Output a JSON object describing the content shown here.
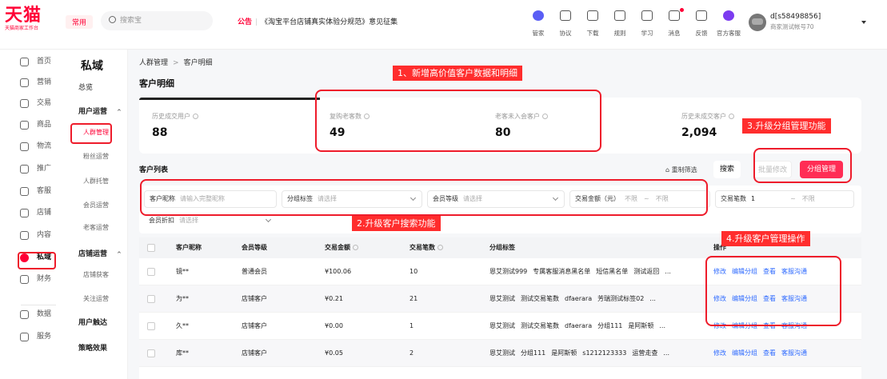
{
  "brand": {
    "logo": "天猫",
    "logo_sub": "天猫商家工作台"
  },
  "header": {
    "common_label": "常用",
    "search_placeholder": "搜索宝",
    "notice_tag": "公告",
    "notice_sep": "|",
    "notice_text": "《淘宝平台店铺真实体验分规范》意见征集",
    "tools": [
      {
        "name": "manager",
        "label": "管家",
        "icon": "manager-icon"
      },
      {
        "name": "agreement",
        "label": "协议",
        "icon": "agreement-icon"
      },
      {
        "name": "download",
        "label": "下载",
        "icon": "download-icon"
      },
      {
        "name": "rules",
        "label": "规则",
        "icon": "rules-icon"
      },
      {
        "name": "learn",
        "label": "学习",
        "icon": "learn-icon"
      },
      {
        "name": "message",
        "label": "消息",
        "icon": "message-icon"
      },
      {
        "name": "feedback",
        "label": "反馈",
        "icon": "feedback-icon"
      },
      {
        "name": "official-service",
        "label": "官方客服",
        "icon": "service-icon"
      }
    ],
    "user_name": "d[s58498856]",
    "user_sub": "商家测试帐号70"
  },
  "leftnav": [
    {
      "label": "首页",
      "icon": "home-icon"
    },
    {
      "label": "营销",
      "icon": "marketing-icon"
    },
    {
      "label": "交易",
      "icon": "trade-icon"
    },
    {
      "label": "商品",
      "icon": "goods-icon"
    },
    {
      "label": "物流",
      "icon": "logistics-icon"
    },
    {
      "label": "推广",
      "icon": "promotion-icon"
    },
    {
      "label": "客服",
      "icon": "customer-service-icon"
    },
    {
      "label": "店铺",
      "icon": "shop-icon"
    },
    {
      "label": "内容",
      "icon": "content-icon"
    },
    {
      "label": "私域",
      "icon": "private-domain-icon"
    },
    {
      "label": "财务",
      "icon": "finance-icon"
    },
    {
      "label": "数据",
      "icon": "data-icon"
    },
    {
      "label": "服务",
      "icon": "service-grid-icon"
    }
  ],
  "subnav": {
    "title": "私域",
    "overview": "总览",
    "group1": "用户运营",
    "group1_items": [
      "人群管理",
      "粉丝运营",
      "人群托管",
      "会员运营",
      "老客运营"
    ],
    "group2": "店铺运营",
    "group2_items": [
      "店铺获客",
      "关注运营"
    ],
    "group3": "用户触达",
    "group4": "策略效果",
    "collapse_arrow": "^"
  },
  "main": {
    "breadcrumb": [
      "人群管理",
      "客户明细"
    ],
    "breadcrumb_sep": ">",
    "page_title": "客户明细",
    "stats": [
      {
        "label": "历史成交用户",
        "value": "88"
      },
      {
        "label": "复购老客数",
        "value": "49"
      },
      {
        "label": "老客未入会客户",
        "value": "80"
      },
      {
        "label": "历史未成交客户",
        "value": "2,094"
      }
    ],
    "list_title": "客户列表",
    "reset_label": "重制筛选",
    "search_btn": "搜索",
    "batch_btn": "批量修改",
    "group_btn": "分组管理",
    "filters": {
      "nickname_label": "客户昵称",
      "nickname_placeholder": "请输入完整昵称",
      "group_tag_label": "分组标签",
      "group_tag_placeholder": "请选择",
      "member_level_label": "会员等级",
      "member_level_placeholder": "请选择",
      "amount_label": "交易金额（元）",
      "amount_from": "不限",
      "amount_to": "不限",
      "count_label": "交易笔数",
      "count_from": "1",
      "count_to": "不限",
      "range_sep": "~",
      "discount_label": "会员折扣",
      "discount_placeholder": "请选择"
    },
    "table": {
      "headers": {
        "nickname": "客户昵称",
        "level": "会员等级",
        "amount": "交易金额",
        "count": "交易笔数",
        "tags": "分组标签",
        "ops": "操作"
      },
      "rows": [
        {
          "nickname": "镜**",
          "level": "普通会员",
          "amount": "¥100.06",
          "count": "10",
          "tags": [
            "恩艾测试999",
            "专属客服消息黑名单",
            "短信黑名单",
            "测试返回",
            "..."
          ]
        },
        {
          "nickname": "为**",
          "level": "店铺客户",
          "amount": "¥0.21",
          "count": "21",
          "tags": [
            "恩艾测试",
            "测试交易笔数",
            "dfaerara",
            "芳瑞测试标签02",
            "..."
          ]
        },
        {
          "nickname": "久**",
          "level": "店铺客户",
          "amount": "¥0.00",
          "count": "1",
          "tags": [
            "恩艾测试",
            "测试交易笔数",
            "dfaerara",
            "分组111",
            "是阿斯顿",
            "..."
          ]
        },
        {
          "nickname": "库**",
          "level": "店铺客户",
          "amount": "¥0.05",
          "count": "2",
          "tags": [
            "恩艾测试",
            "分组111",
            "是阿斯顿",
            "s1212123333",
            "运营走查",
            "..."
          ]
        }
      ],
      "ops": [
        "修改",
        "编辑分组",
        "查看",
        "客服沟通"
      ]
    }
  },
  "annotations": [
    "1、新增高价值客户数据和明细",
    "2.升级客户搜索功能",
    "3.升级分组管理功能",
    "4.升级客户管理操作"
  ],
  "colors": {
    "brand_red": "#ff0036",
    "link_blue": "#2f6bff",
    "annotation_red": "#ee1c2b"
  }
}
